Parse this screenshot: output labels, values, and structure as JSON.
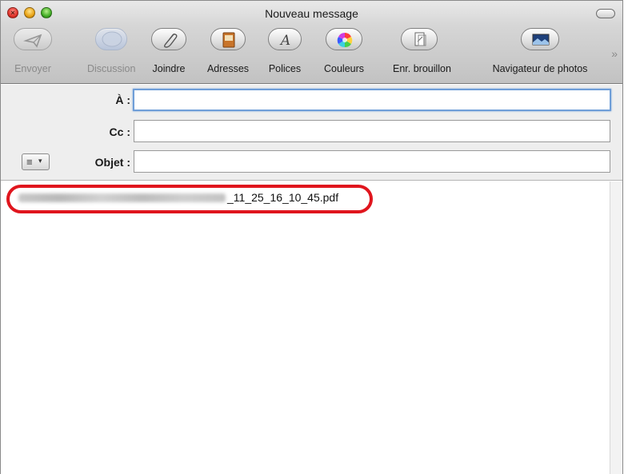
{
  "window": {
    "title": "Nouveau message"
  },
  "toolbar": {
    "items": [
      {
        "label": "Envoyer",
        "icon": "send-plane-icon",
        "enabled": false
      },
      {
        "label": "Discussion",
        "icon": "chat-bubble-icon",
        "enabled": false
      },
      {
        "label": "Joindre",
        "icon": "paperclip-icon",
        "enabled": true
      },
      {
        "label": "Adresses",
        "icon": "address-book-icon",
        "enabled": true
      },
      {
        "label": "Polices",
        "icon": "font-icon",
        "enabled": true
      },
      {
        "label": "Couleurs",
        "icon": "color-wheel-icon",
        "enabled": true
      },
      {
        "label": "Enr. brouillon",
        "icon": "draft-document-icon",
        "enabled": true
      },
      {
        "label": "Navigateur de photos",
        "icon": "photo-browser-icon",
        "enabled": true
      }
    ],
    "overflow": "»"
  },
  "headers": {
    "to_label": "À :",
    "to_value": "",
    "cc_label": "Cc :",
    "cc_value": "",
    "subject_label": "Objet :",
    "subject_value": "",
    "format_icon": "≡",
    "format_arrow": "▾"
  },
  "body": {
    "attachment_visible_suffix": "_11_25_16_10_45.pdf"
  },
  "colors": {
    "highlight": "#e0151d",
    "focus_ring": "#6f9ed8"
  }
}
